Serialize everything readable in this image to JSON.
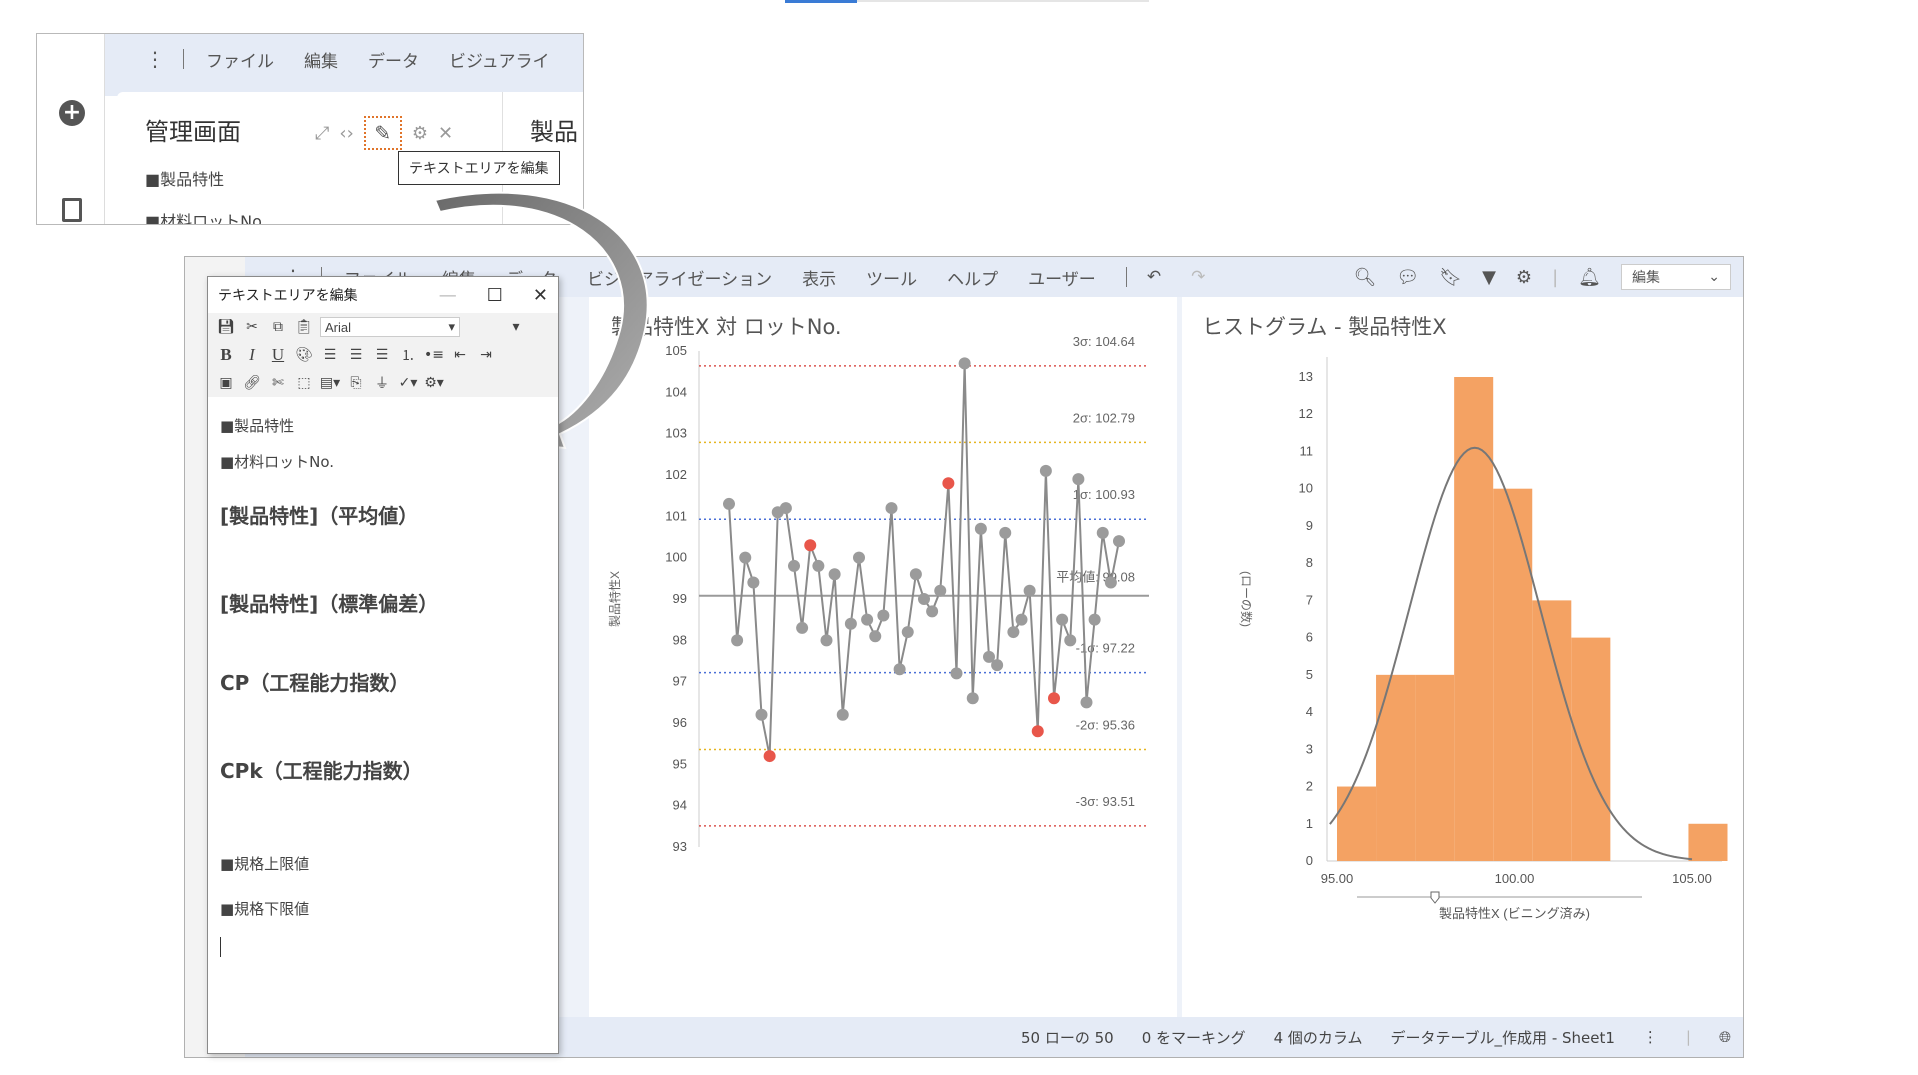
{
  "inset": {
    "menu": [
      "ファイル",
      "編集",
      "データ",
      "ビジュアライ"
    ],
    "panel_title": "管理画面",
    "right_title": "製品",
    "tooltip": "テキストエリアを編集",
    "lines": [
      "■製品特性",
      "■材料ロットNo."
    ]
  },
  "main": {
    "menu": [
      "ファイル",
      "編集",
      "データ",
      "ビジュアライゼーション",
      "表示",
      "ツール",
      "ヘルプ",
      "ユーザー"
    ],
    "edit_mode": "編集",
    "status": [
      "50 ローの 50",
      "0 をマーキング",
      "4 個のカラム",
      "データテーブル_作成用 - Sheet1"
    ]
  },
  "dialog": {
    "title": "テキストエリアを編集",
    "font": "Arial",
    "lines_small_1": "■製品特性",
    "lines_small_2": "■材料ロットNo.",
    "heading_1": "[製品特性]（平均値）",
    "heading_2": "[製品特性]（標準偏差）",
    "heading_3": "CP（工程能力指数）",
    "heading_4": "CPk（工程能力指数）",
    "limit_upper": "■規格上限値",
    "limit_lower": "■規格下限値"
  },
  "chart_data": [
    {
      "type": "line",
      "title": "製品特性X 対 ロットNo.",
      "ylabel": "製品特性X",
      "ylim": [
        93,
        105
      ],
      "y_ticks": [
        93,
        94,
        95,
        96,
        97,
        98,
        99,
        100,
        101,
        102,
        103,
        104,
        105
      ],
      "values": [
        101.3,
        98.0,
        100.0,
        99.4,
        96.2,
        95.2,
        101.1,
        101.2,
        99.8,
        98.3,
        100.3,
        99.8,
        98.0,
        99.6,
        96.2,
        98.4,
        100.0,
        98.5,
        98.1,
        98.6,
        101.2,
        97.3,
        98.2,
        99.6,
        99.0,
        98.7,
        99.2,
        101.8,
        97.2,
        104.7,
        96.6,
        100.7,
        97.6,
        97.4,
        100.6,
        98.2,
        98.5,
        99.2,
        95.8,
        102.1,
        96.6,
        98.5,
        98.0,
        101.9,
        96.5,
        98.5,
        100.6,
        99.4,
        100.4
      ],
      "red_points": [
        5,
        10,
        27,
        38,
        40
      ],
      "control_lines": [
        {
          "label": "3σ: 104.64",
          "value": 104.64,
          "color": "#d9534f"
        },
        {
          "label": "2σ: 102.79",
          "value": 102.79,
          "color": "#e6b520"
        },
        {
          "label": "1σ: 100.93",
          "value": 100.93,
          "color": "#4a6fd6"
        },
        {
          "label": "平均値: 99.08",
          "value": 99.08,
          "color": "#9a9a9a"
        },
        {
          "label": "-1σ: 97.22",
          "value": 97.22,
          "color": "#4a6fd6"
        },
        {
          "label": "-2σ: 95.36",
          "value": 95.36,
          "color": "#e6b520"
        },
        {
          "label": "-3σ: 93.51",
          "value": 93.51,
          "color": "#d9534f"
        }
      ]
    },
    {
      "type": "bar",
      "title": "ヒストグラム - 製品特性X",
      "xlabel": "製品特性X (ビニング済み)",
      "ylabel": "(ローの数)",
      "x_ticks": [
        "95.00",
        "100.00",
        "105.00"
      ],
      "xlim": [
        95,
        105
      ],
      "ylim": [
        0,
        13
      ],
      "y_ticks": [
        0,
        1,
        2,
        3,
        4,
        5,
        6,
        7,
        8,
        9,
        10,
        11,
        12,
        13
      ],
      "bin_edges": [
        95.0,
        96.1,
        97.2,
        98.3,
        99.4,
        100.5,
        101.6,
        102.7,
        103.8,
        104.9
      ],
      "values": [
        2,
        5,
        5,
        13,
        10,
        7,
        6,
        0,
        0,
        1
      ],
      "bar_color": "#f4a263",
      "curve_color": "#777777"
    }
  ]
}
